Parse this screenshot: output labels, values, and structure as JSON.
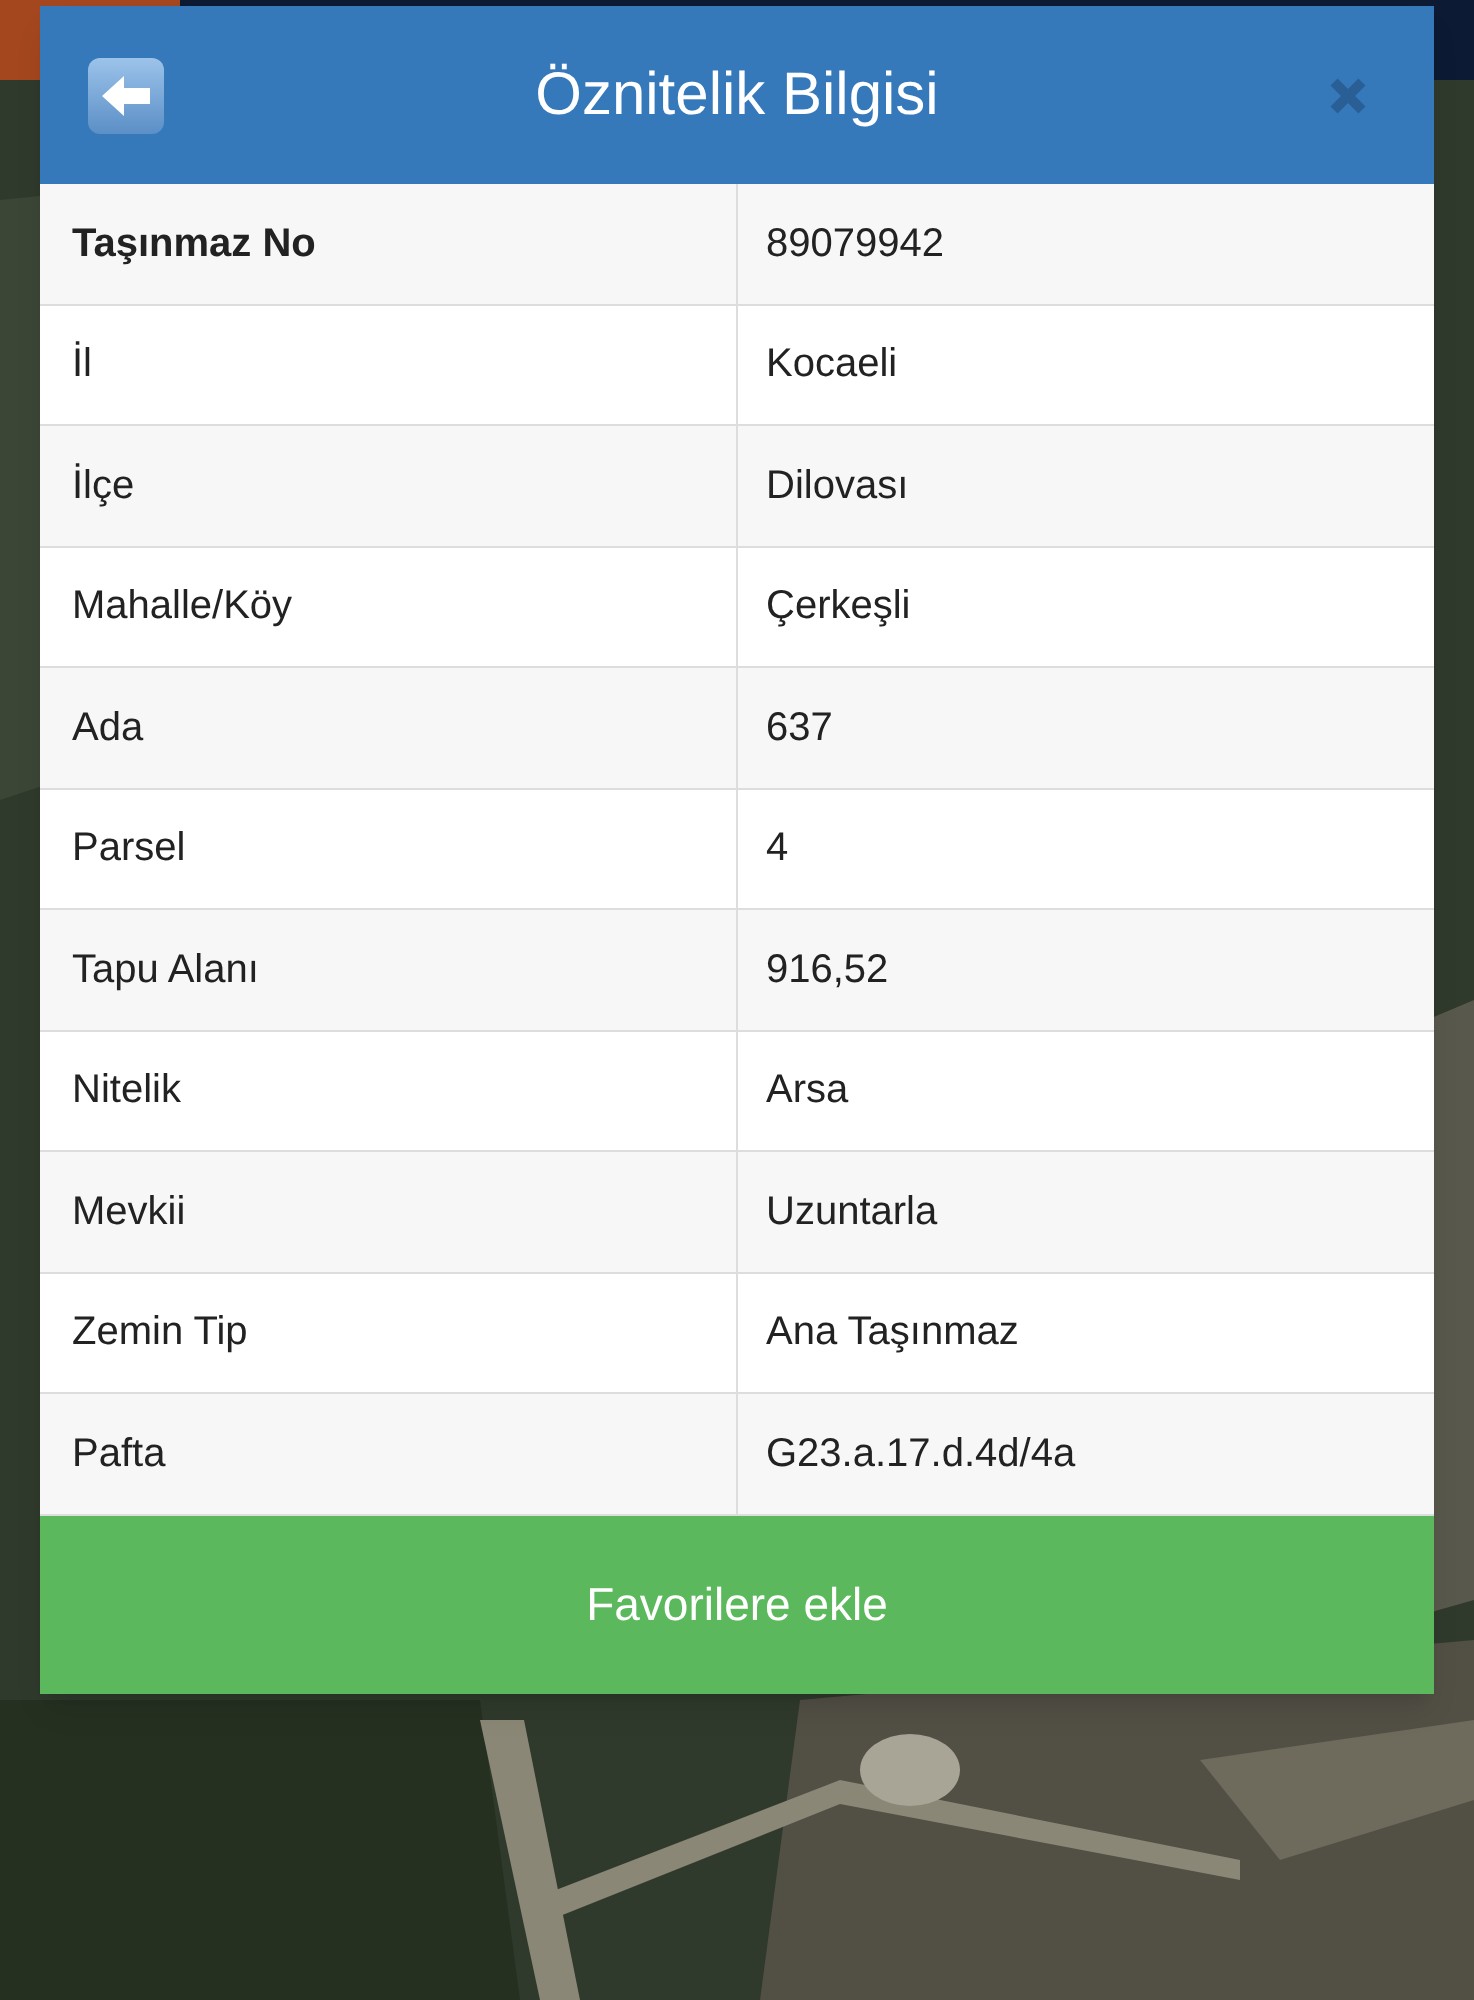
{
  "dialog": {
    "title": "Öznitelik Bilgisi"
  },
  "rows": [
    {
      "kind": "heading",
      "label": "Taşınmaz No",
      "value": "89079942"
    },
    {
      "kind": "field",
      "label": "İl",
      "value": "Kocaeli"
    },
    {
      "kind": "field",
      "label": "İlçe",
      "value": "Dilovası"
    },
    {
      "kind": "field",
      "label": "Mahalle/Köy",
      "value": "Çerkeşli"
    },
    {
      "kind": "field",
      "label": "Ada",
      "value": "637"
    },
    {
      "kind": "field",
      "label": "Parsel",
      "value": "4"
    },
    {
      "kind": "field",
      "label": "Tapu Alanı",
      "value": "916,52"
    },
    {
      "kind": "field",
      "label": "Nitelik",
      "value": "Arsa"
    },
    {
      "kind": "field",
      "label": "Mevkii",
      "value": "Uzuntarla"
    },
    {
      "kind": "field",
      "label": "Zemin Tip",
      "value": "Ana Taşınmaz"
    },
    {
      "kind": "field",
      "label": "Pafta",
      "value": "G23.a.17.d.4d/4a"
    }
  ],
  "button": {
    "label": "Favorilere ekle"
  }
}
